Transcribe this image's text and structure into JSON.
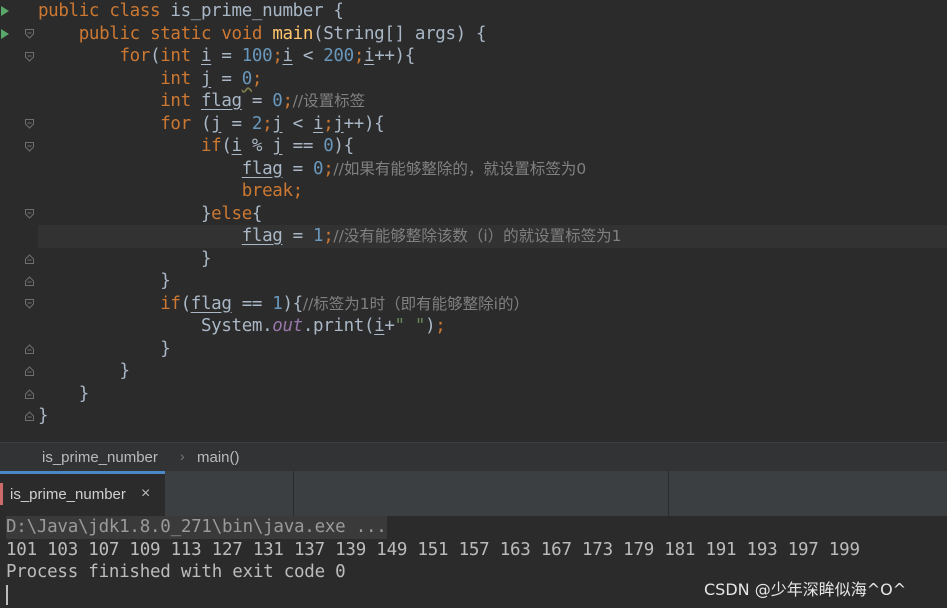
{
  "editor": {
    "lines": [
      "public class is_prime_number {",
      "    public static void main(String[] args) {",
      "        for(int i = 100;i < 200;i++){",
      "            int j = 0;",
      "            int flag = 0;//设置标签",
      "            for (j = 2;j < i;j++){",
      "                if(i % j == 0){",
      "                    flag = 0;//如果有能够整除的，就设置标签为0",
      "                    break;",
      "                }else{",
      "                    flag = 1;//没有能够整除该数（i）的就设置标签为1",
      "                }",
      "            }",
      "            if(flag == 1){//标签为1时（即有能够整除i的）",
      "                System.out.print(i+\" \");",
      "            }",
      "        }",
      "    }",
      "}"
    ]
  },
  "breadcrumb": {
    "items": [
      "is_prime_number",
      "main()"
    ],
    "separator": "›"
  },
  "run_panel": {
    "tab_label": "is_prime_number",
    "close_glyph": "×"
  },
  "console": {
    "command": "D:\\Java\\jdk1.8.0_271\\bin\\java.exe ...",
    "output": "101 103 107 109 113 127 131 137 139 149 151 157 163 167 173 179 181 191 193 197 199",
    "exit_message": "Process finished with exit code 0"
  },
  "watermark": "CSDN @少年深眸似海^O^",
  "colors": {
    "background": "#2b2b2b",
    "keyword": "#cc7832",
    "method": "#ffc66d",
    "number": "#6897bb",
    "comment": "#808080",
    "string": "#6a8759",
    "field": "#9876aa",
    "run_gutter": "#59a869"
  }
}
